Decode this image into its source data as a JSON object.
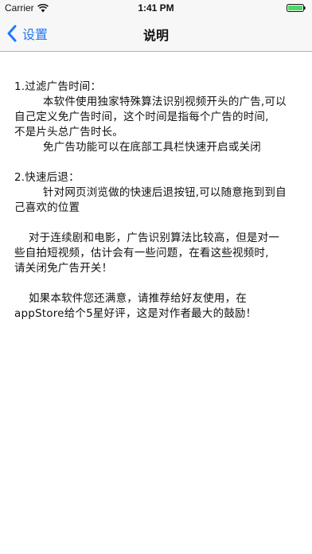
{
  "status_bar": {
    "carrier": "Carrier",
    "time": "1:41 PM",
    "wifi_icon": "wifi-icon",
    "battery_icon": "battery-icon"
  },
  "nav": {
    "back_label": "设置",
    "back_icon": "chevron-left-icon",
    "title": "说明",
    "accent_color": "#1f7af6"
  },
  "sections": [
    {
      "lines": [
        "1.过滤广告时间：",
        "        本软件使用独家特殊算法识别视频开头的广告,可以",
        "自己定义免广告时间，这个时间是指每个广告的时间,",
        "不是片头总广告时长。",
        "        免广告功能可以在底部工具栏快速开启或关闭"
      ]
    },
    {
      "lines": [
        "2.快速后退：",
        "        针对网页浏览做的快速后退按钮,可以随意拖到到自",
        "己喜欢的位置"
      ]
    },
    {
      "lines": [
        "    对于连续剧和电影，广告识别算法比较高，但是对一",
        "些自拍短视频，估计会有一些问题，在看这些视频时,",
        "请关闭免广告开关！"
      ]
    },
    {
      "lines": [
        "    如果本软件您还满意，请推荐给好友使用，在",
        "appStore给个5星好评，这是对作者最大的鼓励！"
      ]
    }
  ]
}
